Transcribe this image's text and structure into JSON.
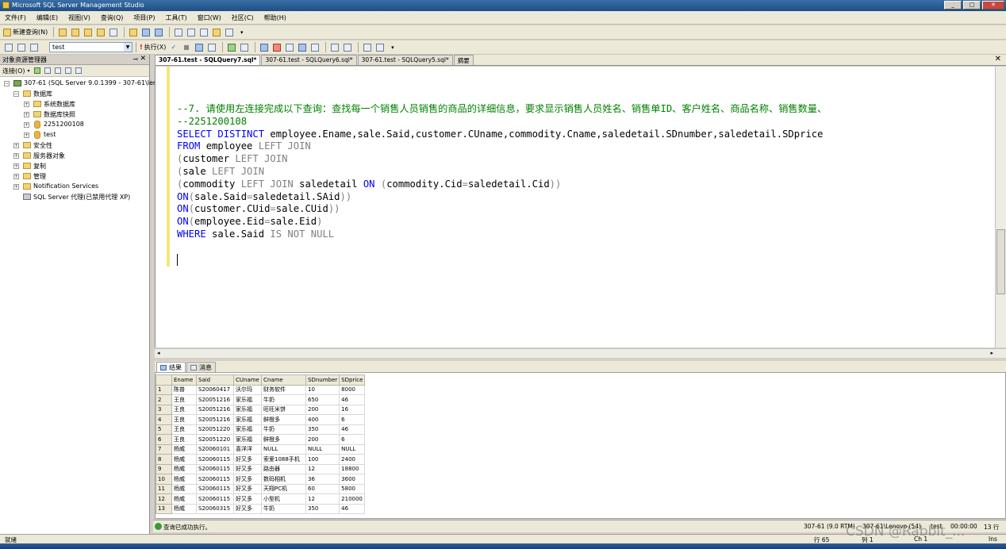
{
  "window": {
    "title": "Microsoft SQL Server Management Studio",
    "buttons": [
      "_",
      "□",
      "✕"
    ]
  },
  "menu": [
    "文件(F)",
    "编辑(E)",
    "视图(V)",
    "查询(Q)",
    "项目(P)",
    "工具(T)",
    "窗口(W)",
    "社区(C)",
    "帮助(H)"
  ],
  "toolbar": {
    "new_query": "新建查询(N)",
    "database": "test",
    "execute": "执行(X)"
  },
  "object_explorer": {
    "title": "对象资源管理器",
    "connect": "连接(O)",
    "nodes": [
      {
        "label": "307-61 (SQL Server 9.0.1399 - 307-61\\len",
        "sign": "−"
      },
      {
        "label": "数据库",
        "sign": "−"
      },
      {
        "label": "系统数据库",
        "sign": "+"
      },
      {
        "label": "数据库快照",
        "sign": "+"
      },
      {
        "label": "2251200108",
        "sign": "+"
      },
      {
        "label": "test",
        "sign": "+"
      },
      {
        "label": "安全性",
        "sign": "+"
      },
      {
        "label": "服务器对象",
        "sign": "+"
      },
      {
        "label": "复制",
        "sign": "+"
      },
      {
        "label": "管理",
        "sign": "+"
      },
      {
        "label": "Notification Services",
        "sign": "+"
      },
      {
        "label": "SQL Server 代理(已禁用代理 XP)",
        "sign": ""
      }
    ]
  },
  "doc_tabs": [
    "307-61.test - SQLQuery7.sql*",
    "307-61.test - SQLQuery6.sql*",
    "307-61.test - SQLQuery5.sql*",
    "摘要"
  ],
  "editor": {
    "lines": [
      [
        {
          "t": "--7. 请使用左连接完成以下查询：查找每一个销售人员销售的商品的详细信息，要求显示销售人员姓名、销售单ID、客户姓名、商品名称、销售数量、",
          "c": "cmt"
        }
      ],
      [
        {
          "t": "--2251200108",
          "c": "cmt"
        }
      ],
      [
        {
          "t": "SELECT DISTINCT",
          "c": "kw"
        },
        {
          "t": " employee.Ename,sale.Said,customer.CUname,commodity.Cname,saledetail.SDnumber,saledetail.SDprice",
          "c": ""
        }
      ],
      [
        {
          "t": "FROM",
          "c": "kw"
        },
        {
          "t": " employee ",
          "c": ""
        },
        {
          "t": "LEFT JOIN",
          "c": "gr"
        }
      ],
      [
        {
          "t": "(",
          "c": "gr"
        },
        {
          "t": "customer ",
          "c": ""
        },
        {
          "t": "LEFT JOIN",
          "c": "gr"
        }
      ],
      [
        {
          "t": "(",
          "c": "gr"
        },
        {
          "t": "sale ",
          "c": ""
        },
        {
          "t": "LEFT JOIN",
          "c": "gr"
        }
      ],
      [
        {
          "t": "(",
          "c": "gr"
        },
        {
          "t": "commodity ",
          "c": ""
        },
        {
          "t": "LEFT JOIN",
          "c": "gr"
        },
        {
          "t": " saledetail ",
          "c": ""
        },
        {
          "t": "ON",
          "c": "kw"
        },
        {
          "t": " (",
          "c": "gr"
        },
        {
          "t": "commodity.Cid",
          "c": ""
        },
        {
          "t": "=",
          "c": "gr"
        },
        {
          "t": "saledetail.Cid",
          "c": ""
        },
        {
          "t": "))",
          "c": "gr"
        }
      ],
      [
        {
          "t": "ON",
          "c": "kw"
        },
        {
          "t": "(",
          "c": "gr"
        },
        {
          "t": "sale.Said",
          "c": ""
        },
        {
          "t": "=",
          "c": "gr"
        },
        {
          "t": "saledetail.SAid",
          "c": ""
        },
        {
          "t": "))",
          "c": "gr"
        }
      ],
      [
        {
          "t": "ON",
          "c": "kw"
        },
        {
          "t": "(",
          "c": "gr"
        },
        {
          "t": "customer.CUid",
          "c": ""
        },
        {
          "t": "=",
          "c": "gr"
        },
        {
          "t": "sale.CUid",
          "c": ""
        },
        {
          "t": "))",
          "c": "gr"
        }
      ],
      [
        {
          "t": "ON",
          "c": "kw"
        },
        {
          "t": "(",
          "c": "gr"
        },
        {
          "t": "employee.Eid",
          "c": ""
        },
        {
          "t": "=",
          "c": "gr"
        },
        {
          "t": "sale.Eid",
          "c": ""
        },
        {
          "t": ")",
          "c": "gr"
        }
      ],
      [
        {
          "t": "WHERE",
          "c": "kw"
        },
        {
          "t": " sale.Said ",
          "c": ""
        },
        {
          "t": "IS NOT NULL",
          "c": "gr"
        }
      ]
    ]
  },
  "results": {
    "tabs": [
      "结果",
      "消息"
    ],
    "columns": [
      "Ename",
      "Said",
      "CUname",
      "Cname",
      "SDnumber",
      "SDprice"
    ],
    "rows": [
      [
        "1",
        "陈普",
        "S20060417",
        "沃尔玛",
        "财务软件",
        "10",
        "8000"
      ],
      [
        "2",
        "王良",
        "S20051216",
        "家乐福",
        "牛奶",
        "650",
        "46"
      ],
      [
        "3",
        "王良",
        "S20051216",
        "家乐福",
        "旺旺米饼",
        "200",
        "16"
      ],
      [
        "4",
        "王良",
        "S20051216",
        "家乐福",
        "鲜橙多",
        "400",
        "6"
      ],
      [
        "5",
        "王良",
        "S20051220",
        "家乐福",
        "牛奶",
        "350",
        "46"
      ],
      [
        "6",
        "王良",
        "S20051220",
        "家乐福",
        "鲜橙多",
        "200",
        "6"
      ],
      [
        "7",
        "杨威",
        "S20060101",
        "喜洋洋",
        "NULL",
        "NULL",
        "NULL"
      ],
      [
        "8",
        "杨威",
        "S20060115",
        "好又多",
        "索爱1088手机",
        "100",
        "2400"
      ],
      [
        "9",
        "杨威",
        "S20060115",
        "好又多",
        "路由器",
        "12",
        "18800"
      ],
      [
        "10",
        "杨威",
        "S20060115",
        "好又多",
        "数码相机",
        "36",
        "3600"
      ],
      [
        "11",
        "杨威",
        "S20060115",
        "好又多",
        "天翔PC机",
        "60",
        "5800"
      ],
      [
        "12",
        "杨威",
        "S20060115",
        "好又多",
        "小型机",
        "12",
        "210000"
      ],
      [
        "13",
        "杨威",
        "S20060315",
        "好又多",
        "牛奶",
        "350",
        "46"
      ]
    ]
  },
  "query_status": {
    "message": "查询已成功执行。",
    "server": "307-61 (9.0 RTM)",
    "user": "307-61\\Lenovo (54)",
    "db": "test",
    "time": "00:00:00",
    "rows": "13 行"
  },
  "status": {
    "ready": "就绪",
    "line": "行 65",
    "col": "列 1",
    "ch": "Ch 1",
    "ins": "Ins"
  },
  "watermark": "CSDN @Rabbit_..."
}
